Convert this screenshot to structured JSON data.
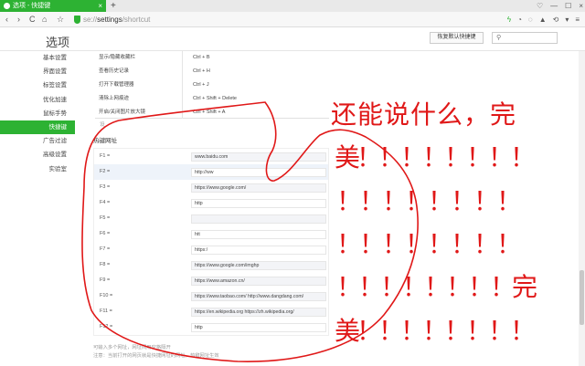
{
  "titlebar": {
    "tab_title": "选项 - 快捷键",
    "tab_close": "×",
    "new_tab": "+",
    "controls": [
      "♡",
      "—",
      "☐",
      "×"
    ]
  },
  "toolbar": {
    "back": "‹",
    "forward": "›",
    "reload": "C",
    "home": "⌂",
    "bookmark": "☆",
    "url_scheme": "se://",
    "url_path": "settings",
    "url_rest": "/shortcut",
    "right_icons": [
      "ϟ",
      "◔",
      "◌",
      "▲",
      "⟲",
      "▾",
      "≡"
    ]
  },
  "header": {
    "title": "选项",
    "restore_label": "恢复默认快捷键",
    "search_placeholder": ""
  },
  "sidebar": {
    "items": [
      "基本设置",
      "界面设置",
      "标签设置",
      "优化加速",
      "鼠标手势",
      "快捷键",
      "广告过滤",
      "高级设置",
      "实验室"
    ],
    "active_index": 5
  },
  "shortcuts": [
    {
      "label": "显示/隐藏收藏栏",
      "key": "Ctrl + B"
    },
    {
      "label": "查看历史记录",
      "key": "Ctrl + H"
    },
    {
      "label": "打开下载管理器",
      "key": "Ctrl + J"
    },
    {
      "label": "清除上网痕迹",
      "key": "Ctrl + Shift + Delete"
    },
    {
      "label": "开启/关闭图片放大镜",
      "key": "Ctrl + Shift + A"
    }
  ],
  "hotkeys": {
    "section_title": "热键网址",
    "partial_label": "设",
    "rows": [
      {
        "label": "F1 =",
        "value": "www.baidu.com"
      },
      {
        "label": "F2 =",
        "value": "http://ww"
      },
      {
        "label": "F3 =",
        "value": "https://www.google.com/"
      },
      {
        "label": "F4 =",
        "value": "http"
      },
      {
        "label": "F5 =",
        "value": ""
      },
      {
        "label": "F6 =",
        "value": "htt"
      },
      {
        "label": "F7 =",
        "value": "https:/"
      },
      {
        "label": "F8 =",
        "value": "https://www.google.com/imghp"
      },
      {
        "label": "F9 =",
        "value": "https://www.amazon.cn/"
      },
      {
        "label": "F10 =",
        "value": "https://www.taobao.com/ http://www.dangdang.com/"
      },
      {
        "label": "F11 =",
        "value": "https://en.wikipedia.org https://zh.wikipedia.org/"
      },
      {
        "label": "F12 =",
        "value": "http"
      }
    ],
    "notes": [
      "可输入多个网址，网址间用空格隔开",
      "注意：当前打开的网页就是快捷网址的网址，热键网址生效"
    ]
  },
  "handwriting": {
    "color": "#e01818",
    "lines": [
      "还能说什么，完",
      "美！！！！！！！！",
      "！！！！！！！！",
      "！！！！！！！！",
      "！！！！！！！！完",
      "美！！！！！！！！"
    ]
  },
  "colors": {
    "accent": "#2db233"
  }
}
